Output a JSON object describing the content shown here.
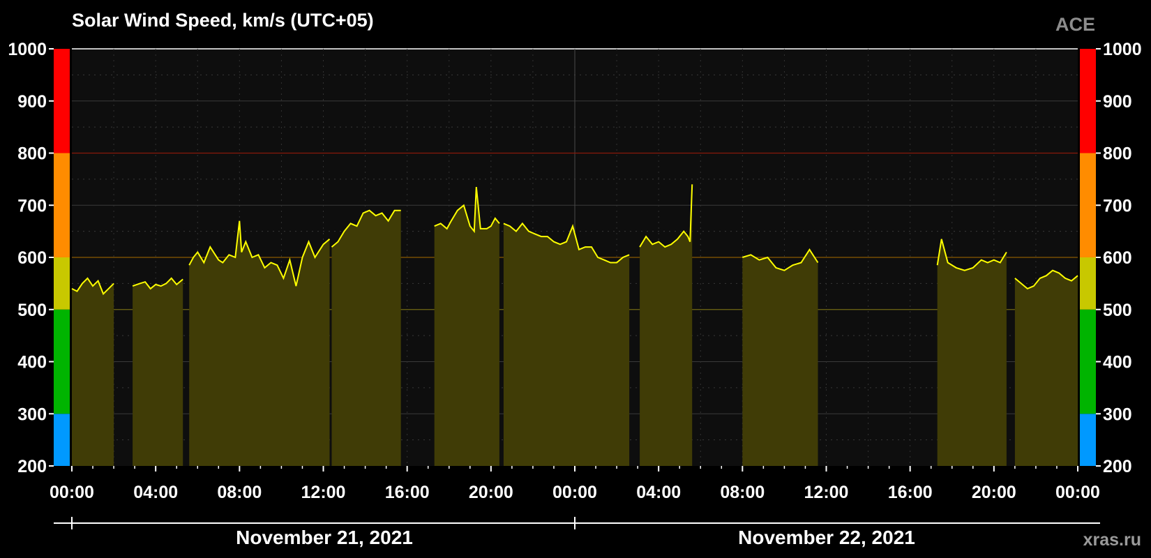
{
  "chart_data": {
    "type": "area",
    "title": "Solar Wind Speed, km/s (UTC+05)",
    "source": "ACE",
    "credit": "xras.ru",
    "ylim": [
      200,
      1000
    ],
    "yticks": [
      200,
      300,
      400,
      500,
      600,
      700,
      800,
      900,
      1000
    ],
    "xlim_hours": [
      0,
      48
    ],
    "xtick_labels": [
      "00:00",
      "04:00",
      "08:00",
      "12:00",
      "16:00",
      "20:00",
      "00:00",
      "04:00",
      "08:00",
      "12:00",
      "16:00",
      "20:00",
      "00:00"
    ],
    "dates": [
      "November 21, 2021",
      "November 22, 2021"
    ],
    "threshold_lines": [
      500,
      600,
      800
    ],
    "scale_bands": [
      {
        "from": 200,
        "to": 300,
        "color": "#0099ff"
      },
      {
        "from": 300,
        "to": 500,
        "color": "#00b400"
      },
      {
        "from": 500,
        "to": 600,
        "color": "#c8c800"
      },
      {
        "from": 600,
        "to": 800,
        "color": "#ff8c00"
      },
      {
        "from": 800,
        "to": 1000,
        "color": "#ff0000"
      }
    ],
    "colors": {
      "line": "#ffff00",
      "fill": "#403c06",
      "plot_bg": "#0e0e0e"
    },
    "segments": [
      {
        "x": [
          0.0,
          0.25,
          0.5,
          0.75,
          1.0,
          1.25,
          1.5,
          1.75,
          2.0
        ],
        "y": [
          540,
          535,
          550,
          560,
          545,
          555,
          530,
          540,
          550
        ]
      },
      {
        "x": [
          2.9,
          3.25,
          3.5,
          3.75,
          4.0,
          4.25,
          4.5,
          4.75,
          5.0,
          5.3
        ],
        "y": [
          545,
          550,
          553,
          540,
          548,
          545,
          550,
          560,
          548,
          558
        ]
      },
      {
        "x": [
          5.6,
          5.8,
          6.0,
          6.3,
          6.6,
          7.0,
          7.2,
          7.5,
          7.8,
          8.0,
          8.1,
          8.3,
          8.6,
          8.9,
          9.2,
          9.5,
          9.8,
          10.1,
          10.4,
          10.7,
          11.0,
          11.3,
          11.6,
          12.0,
          12.3
        ],
        "y": [
          585,
          600,
          610,
          590,
          620,
          595,
          590,
          605,
          600,
          670,
          610,
          630,
          600,
          605,
          580,
          590,
          585,
          560,
          595,
          545,
          600,
          630,
          600,
          625,
          635
        ]
      },
      {
        "x": [
          12.4,
          12.7,
          13.0,
          13.3,
          13.6,
          13.9,
          14.2,
          14.5,
          14.8,
          15.1,
          15.4,
          15.7
        ],
        "y": [
          620,
          630,
          650,
          665,
          660,
          685,
          690,
          680,
          685,
          670,
          690,
          690
        ]
      },
      {
        "x": [
          17.3,
          17.6,
          17.9,
          18.1,
          18.4,
          18.7,
          19.0,
          19.2,
          19.3,
          19.5,
          19.8,
          20.0,
          20.2,
          20.4
        ],
        "y": [
          660,
          665,
          655,
          670,
          690,
          700,
          660,
          650,
          735,
          655,
          655,
          660,
          675,
          665
        ]
      },
      {
        "x": [
          20.6,
          20.9,
          21.2,
          21.5,
          21.8,
          22.1,
          22.4,
          22.7,
          23.0,
          23.3,
          23.6,
          23.9,
          24.2,
          24.5,
          24.8,
          25.1,
          25.4,
          25.7,
          26.0,
          26.3,
          26.6
        ],
        "y": [
          665,
          660,
          650,
          665,
          650,
          645,
          640,
          640,
          630,
          625,
          630,
          660,
          615,
          620,
          620,
          600,
          595,
          590,
          590,
          600,
          605
        ]
      },
      {
        "x": [
          27.1,
          27.4,
          27.7,
          28.0,
          28.3,
          28.6,
          28.9,
          29.2,
          29.4,
          29.5,
          29.6
        ],
        "y": [
          620,
          640,
          625,
          630,
          620,
          625,
          635,
          650,
          640,
          630,
          740
        ]
      },
      {
        "x": [
          32.0,
          32.4,
          32.8,
          33.2,
          33.6,
          34.0,
          34.4,
          34.8,
          35.2,
          35.6
        ],
        "y": [
          600,
          605,
          595,
          600,
          580,
          575,
          585,
          590,
          615,
          590
        ]
      },
      {
        "x": [
          41.3,
          41.5,
          41.8,
          42.2,
          42.6,
          43.0,
          43.4,
          43.7,
          44.0,
          44.3,
          44.6
        ],
        "y": [
          585,
          635,
          590,
          580,
          575,
          580,
          595,
          590,
          595,
          590,
          610
        ]
      },
      {
        "x": [
          45.0,
          45.3,
          45.6,
          45.9,
          46.2,
          46.5,
          46.8,
          47.1,
          47.4,
          47.7,
          48.0
        ],
        "y": [
          560,
          550,
          540,
          545,
          560,
          565,
          575,
          570,
          560,
          555,
          565
        ]
      }
    ]
  }
}
